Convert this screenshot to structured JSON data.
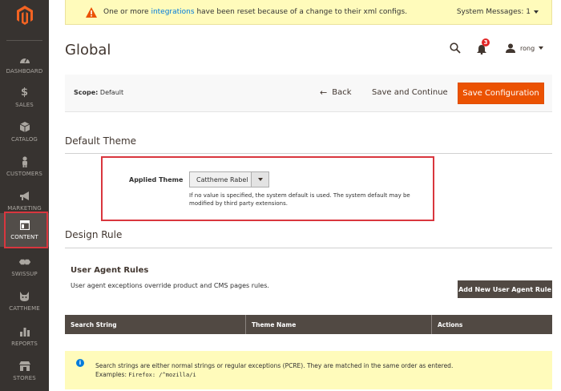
{
  "sidebar": {
    "items": [
      {
        "label": "DASHBOARD",
        "icon": "gauge-icon"
      },
      {
        "label": "SALES",
        "icon": "dollar-icon"
      },
      {
        "label": "CATALOG",
        "icon": "cube-icon"
      },
      {
        "label": "CUSTOMERS",
        "icon": "person-icon"
      },
      {
        "label": "MARKETING",
        "icon": "megaphone-icon"
      },
      {
        "label": "CONTENT",
        "icon": "layout-icon"
      },
      {
        "label": "SWISSUP",
        "icon": "swissup-icon"
      },
      {
        "label": "CATTHEME",
        "icon": "cat-icon"
      },
      {
        "label": "REPORTS",
        "icon": "bar-chart-icon"
      },
      {
        "label": "STORES",
        "icon": "store-icon"
      }
    ]
  },
  "system_message": {
    "before": "One or more ",
    "link": "integrations",
    "after": " have been reset because of a change to their xml configs.",
    "right_label": "System Messages: 1"
  },
  "header": {
    "title": "Global",
    "notification_count": "3",
    "username": "rong"
  },
  "actionbar": {
    "scope_label": "Scope:",
    "scope_value": "Default",
    "back": "Back",
    "save_continue": "Save and Continue",
    "save_config": "Save Configuration"
  },
  "default_theme": {
    "section_title": "Default Theme",
    "label": "Applied Theme",
    "selected": "Cattheme Rabel",
    "note": "If no value is specified, the system default is used. The system default may be modified by third party extensions."
  },
  "design_rule": {
    "section_title": "Design Rule",
    "ua_title": "User Agent Rules",
    "ua_desc": "User agent exceptions override product and CMS pages rules.",
    "add_button": "Add New User Agent Rule",
    "columns": [
      "Search String",
      "Theme Name",
      "Actions"
    ]
  },
  "notice": {
    "line1": "Search strings are either normal strings or regular exceptions (PCRE). They are matched in the same order as entered.",
    "line2_prefix": "Examples:",
    "line2_code": "Firefox: /^mozilla/i"
  },
  "colors": {
    "sidebar_bg": "#373330",
    "accent": "#eb5202",
    "highlight": "#d9363e",
    "table_head": "#514943"
  }
}
